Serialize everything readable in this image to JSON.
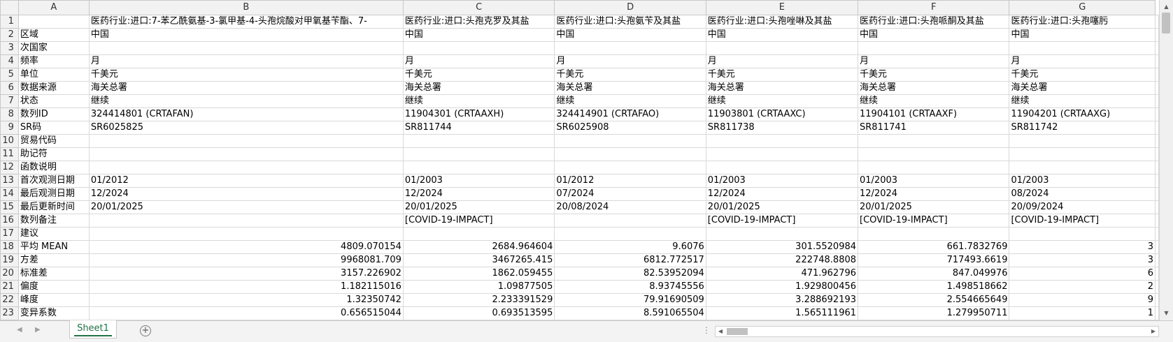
{
  "columns": [
    "A",
    "B",
    "C",
    "D",
    "E",
    "F",
    "G"
  ],
  "rows": [
    {
      "n": "1",
      "a": "",
      "cells": [
        "医药行业:进口:7-苯乙酰氨基-3-氯甲基-4-头孢烷酸对甲氧基苄酯、7-",
        "医药行业:进口:头孢克罗及其盐",
        "医药行业:进口:头孢氨苄及其盐",
        "医药行业:进口:头孢唑啉及其盐",
        "医药行业:进口:头孢哌酮及其盐",
        "医药行业:进口:头孢噻肟"
      ]
    },
    {
      "n": "2",
      "a": "区域",
      "cells": [
        "中国",
        "中国",
        "中国",
        "中国",
        "中国",
        "中国"
      ]
    },
    {
      "n": "3",
      "a": "次国家",
      "cells": [
        "",
        "",
        "",
        "",
        "",
        ""
      ]
    },
    {
      "n": "4",
      "a": "频率",
      "cells": [
        "月",
        "月",
        "月",
        "月",
        "月",
        "月"
      ]
    },
    {
      "n": "5",
      "a": "单位",
      "cells": [
        "千美元",
        "千美元",
        "千美元",
        "千美元",
        "千美元",
        "千美元"
      ]
    },
    {
      "n": "6",
      "a": "数据来源",
      "cells": [
        "海关总署",
        "海关总署",
        "海关总署",
        "海关总署",
        "海关总署",
        "海关总署"
      ]
    },
    {
      "n": "7",
      "a": "状态",
      "cells": [
        "继续",
        "继续",
        "继续",
        "继续",
        "继续",
        "继续"
      ]
    },
    {
      "n": "8",
      "a": "数列ID",
      "cells": [
        "324414801 (CRTAFAN)",
        "11904301 (CRTAAXH)",
        "324414901 (CRTAFAO)",
        "11903801 (CRTAAXC)",
        "11904101 (CRTAAXF)",
        "11904201 (CRTAAXG)"
      ]
    },
    {
      "n": "9",
      "a": "SR码",
      "cells": [
        "SR6025825",
        "SR811744",
        "SR6025908",
        "SR811738",
        "SR811741",
        "SR811742"
      ]
    },
    {
      "n": "10",
      "a": "贸易代码",
      "cells": [
        "",
        "",
        "",
        "",
        "",
        ""
      ]
    },
    {
      "n": "11",
      "a": "助记符",
      "cells": [
        "",
        "",
        "",
        "",
        "",
        ""
      ]
    },
    {
      "n": "12",
      "a": "函数说明",
      "cells": [
        "",
        "",
        "",
        "",
        "",
        ""
      ]
    },
    {
      "n": "13",
      "a": "首次观测日期",
      "cells": [
        "01/2012",
        "01/2003",
        "01/2012",
        "01/2003",
        "01/2003",
        "01/2003"
      ]
    },
    {
      "n": "14",
      "a": "最后观测日期",
      "cells": [
        "12/2024",
        "12/2024",
        "07/2024",
        "12/2024",
        "12/2024",
        "08/2024"
      ]
    },
    {
      "n": "15",
      "a": "最后更新时间",
      "cells": [
        "20/01/2025",
        "20/01/2025",
        "20/08/2024",
        "20/01/2025",
        "20/01/2025",
        "20/09/2024"
      ]
    },
    {
      "n": "16",
      "a": "数列备注",
      "cells": [
        "",
        "[COVID-19-IMPACT]",
        "",
        "[COVID-19-IMPACT]",
        "[COVID-19-IMPACT]",
        "[COVID-19-IMPACT]"
      ]
    },
    {
      "n": "17",
      "a": "建议",
      "cells": [
        "",
        "",
        "",
        "",
        "",
        ""
      ]
    },
    {
      "n": "18",
      "a": "平均 MEAN",
      "num": true,
      "cells": [
        "4809.070154",
        "2684.964604",
        "9.6076",
        "301.5520984",
        "661.7832769",
        "3"
      ]
    },
    {
      "n": "19",
      "a": "方差",
      "num": true,
      "cells": [
        "9968081.709",
        "3467265.415",
        "6812.772517",
        "222748.8808",
        "717493.6619",
        "3"
      ]
    },
    {
      "n": "20",
      "a": "标准差",
      "num": true,
      "cells": [
        "3157.226902",
        "1862.059455",
        "82.53952094",
        "471.962796",
        "847.049976",
        "6"
      ]
    },
    {
      "n": "21",
      "a": "偏度",
      "num": true,
      "cells": [
        "1.182115016",
        "1.09877505",
        "8.93745556",
        "1.929800456",
        "1.498518662",
        "2"
      ]
    },
    {
      "n": "22",
      "a": "峰度",
      "num": true,
      "cells": [
        "1.32350742",
        "2.233391529",
        "79.91690509",
        "3.288692193",
        "2.554665649",
        "9"
      ]
    },
    {
      "n": "23",
      "a": "变异系数",
      "num": true,
      "cells": [
        "0.656515044",
        "0.693513595",
        "8.591065504",
        "1.565111961",
        "1.279950711",
        "1"
      ]
    }
  ],
  "sheet_tab": "Sheet1",
  "add_sheet_symbol": "+",
  "accent_color": "#217346"
}
